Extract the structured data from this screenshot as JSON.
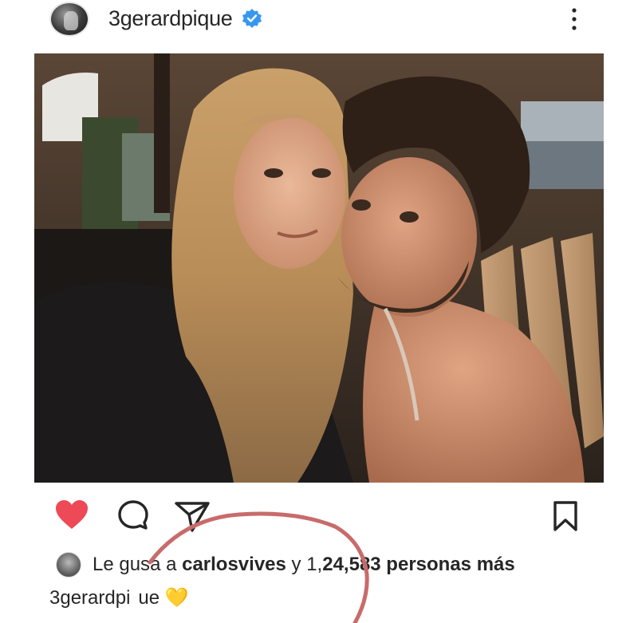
{
  "post": {
    "username": "3gerardpique",
    "verified": true
  },
  "actions": {
    "like_icon": "heart-filled-icon",
    "comment_icon": "comment-icon",
    "share_icon": "send-icon",
    "save_icon": "bookmark-icon"
  },
  "likes": {
    "prefix": "Le gus",
    "gap": "a a ",
    "user": "carlosvives",
    "middle": " y 1,",
    "count_tail": "24,583",
    "suffix": " personas más"
  },
  "caption": {
    "user_start": "3gerardpi",
    "user_end": "ue",
    "emoji": "💛"
  },
  "colors": {
    "like_red": "#ed4956",
    "verified_blue": "#3897f0",
    "marker": "#c86b6b"
  }
}
